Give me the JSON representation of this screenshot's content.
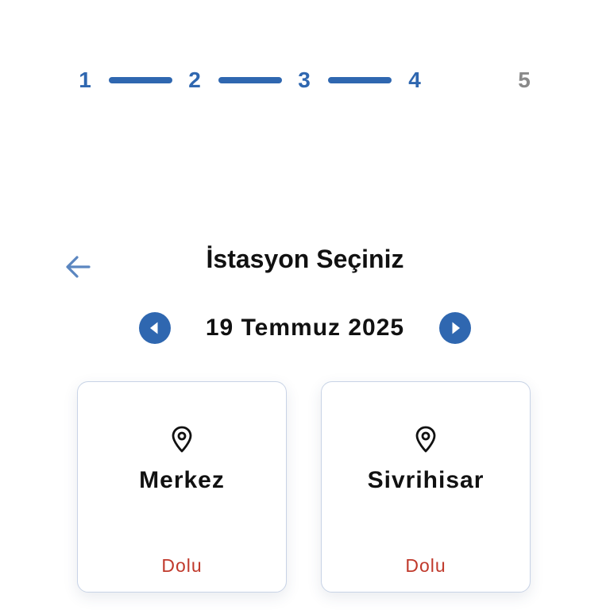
{
  "stepper": {
    "steps": [
      {
        "label": "1",
        "state": "completed"
      },
      {
        "label": "2",
        "state": "completed"
      },
      {
        "label": "3",
        "state": "completed"
      },
      {
        "label": "4",
        "state": "current"
      },
      {
        "label": "5",
        "state": "upcoming"
      }
    ]
  },
  "header": {
    "back_icon": "arrow-left-icon",
    "title": "İstasyon Seçiniz"
  },
  "date_nav": {
    "prev_icon": "chevron-left-circle-icon",
    "date": "19 Temmuz 2025",
    "next_icon": "chevron-right-circle-icon"
  },
  "stations": [
    {
      "name": "Merkez",
      "status": "Dolu",
      "icon": "map-pin-icon"
    },
    {
      "name": "Sivrihisar",
      "status": "Dolu",
      "icon": "map-pin-icon"
    }
  ],
  "colors": {
    "accent": "#2f67b0",
    "inactive": "#8a8a8a",
    "status_full": "#c0392b",
    "back_arrow": "#5b86c0"
  }
}
